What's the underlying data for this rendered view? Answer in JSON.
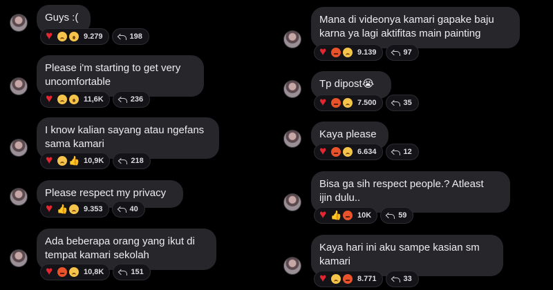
{
  "left_messages": [
    {
      "text": "Guys :(",
      "reactions": [
        "heart",
        "sad",
        "wow"
      ],
      "reaction_count": "9.279",
      "reply_count": "198"
    },
    {
      "text": "Please i'm starting to get very\nuncomfortable",
      "reactions": [
        "heart",
        "sad",
        "wow"
      ],
      "reaction_count": "11,6K",
      "reply_count": "236"
    },
    {
      "text": "I know kalian sayang atau ngefans\nsama kamari",
      "reactions": [
        "heart",
        "sad",
        "thumb"
      ],
      "reaction_count": "10,9K",
      "reply_count": "218"
    },
    {
      "text": "Please respect my privacy",
      "reactions": [
        "heart",
        "thumb",
        "sad"
      ],
      "reaction_count": "9.353",
      "reply_count": "40"
    },
    {
      "text": "Ada beberapa orang yang ikut di\ntempat kamari sekolah",
      "reactions": [
        "heart",
        "angry",
        "sad"
      ],
      "reaction_count": "10,8K",
      "reply_count": "151"
    }
  ],
  "right_messages": [
    {
      "text": "Mana di videonya kamari gapake baju\nkarna ya lagi aktifitas main painting",
      "reactions": [
        "heart",
        "angry",
        "sad"
      ],
      "reaction_count": "9.139",
      "reply_count": "97"
    },
    {
      "text": "Tp dipost😭",
      "reactions": [
        "heart",
        "angry",
        "sad"
      ],
      "reaction_count": "7.500",
      "reply_count": "35"
    },
    {
      "text": "Kaya please",
      "reactions": [
        "heart",
        "angry",
        "sad"
      ],
      "reaction_count": "6.634",
      "reply_count": "12"
    },
    {
      "text": "Bisa ga sih respect people.? Atleast\nijin dulu..",
      "reactions": [
        "heart",
        "thumb",
        "angry"
      ],
      "reaction_count": "10K",
      "reply_count": "59"
    },
    {
      "text": "Kaya hari ini aku sampe kasian sm\nkamari",
      "reactions": [
        "heart",
        "sad",
        "angry"
      ],
      "reaction_count": "8.771",
      "reply_count": "33"
    }
  ]
}
